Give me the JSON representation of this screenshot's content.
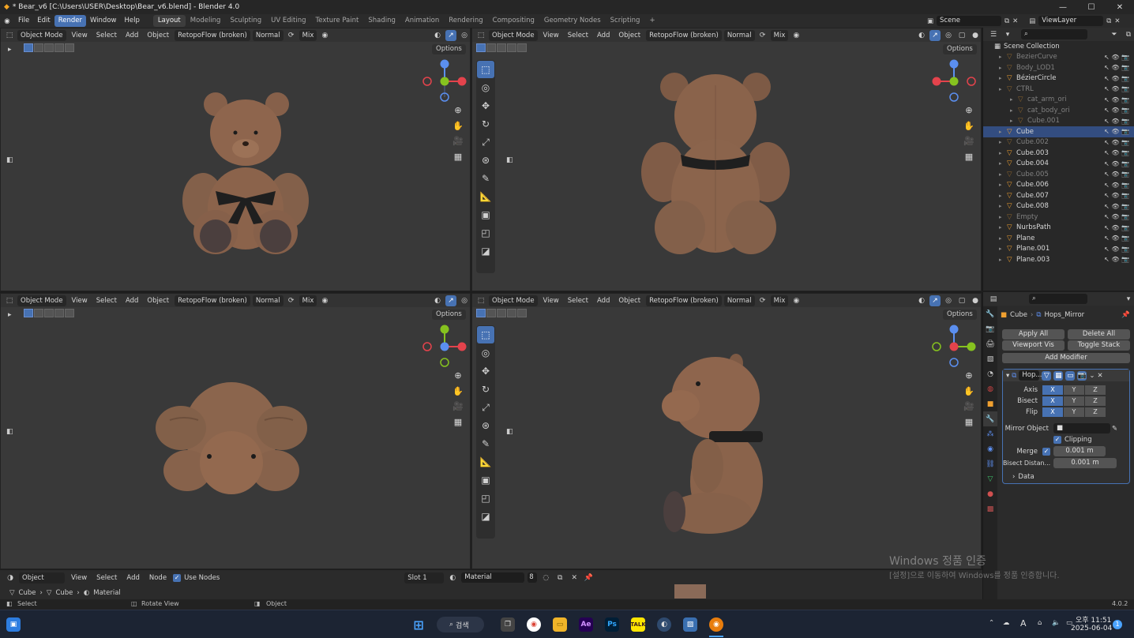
{
  "window": {
    "title": "* Bear_v6 [C:\\Users\\USER\\Desktop\\Bear_v6.blend] - Blender 4.0"
  },
  "menu": {
    "items": [
      "File",
      "Edit",
      "Render",
      "Window",
      "Help"
    ],
    "active": "Render"
  },
  "workspaces": [
    "Layout",
    "Modeling",
    "Sculpting",
    "UV Editing",
    "Texture Paint",
    "Shading",
    "Animation",
    "Rendering",
    "Compositing",
    "Geometry Nodes",
    "Scripting"
  ],
  "workspace_active": "Layout",
  "scene": {
    "name": "Scene",
    "view_layer": "ViewLayer"
  },
  "viewport_header": {
    "mode": "Object Mode",
    "view": "View",
    "select": "Select",
    "add": "Add",
    "object": "Object",
    "addon": "RetopoFlow (broken)",
    "orientation": "Normal",
    "mix": "Mix",
    "options": "Options"
  },
  "outliner": {
    "title": "Scene Collection",
    "items": [
      {
        "name": "BezierCurve",
        "dim": true,
        "selected": false
      },
      {
        "name": "Body_LOD1",
        "dim": true,
        "selected": false
      },
      {
        "name": "BézierCircle",
        "dim": false,
        "selected": false
      },
      {
        "name": "CTRL",
        "dim": true,
        "selected": false
      },
      {
        "name": "cat_arm_ori",
        "dim": true,
        "selected": false
      },
      {
        "name": "cat_body_ori",
        "dim": true,
        "selected": false
      },
      {
        "name": "Cube.001",
        "dim": true,
        "selected": false
      },
      {
        "name": "Cube",
        "dim": false,
        "selected": true
      },
      {
        "name": "Cube.002",
        "dim": true,
        "selected": false
      },
      {
        "name": "Cube.003",
        "dim": false,
        "selected": false
      },
      {
        "name": "Cube.004",
        "dim": false,
        "selected": false
      },
      {
        "name": "Cube.005",
        "dim": true,
        "selected": false
      },
      {
        "name": "Cube.006",
        "dim": false,
        "selected": false
      },
      {
        "name": "Cube.007",
        "dim": false,
        "selected": false
      },
      {
        "name": "Cube.008",
        "dim": false,
        "selected": false
      },
      {
        "name": "Empty",
        "dim": true,
        "selected": false
      },
      {
        "name": "NurbsPath",
        "dim": false,
        "selected": false
      },
      {
        "name": "Plane",
        "dim": false,
        "selected": false
      },
      {
        "name": "Plane.001",
        "dim": false,
        "selected": false
      },
      {
        "name": "Plane.003",
        "dim": false,
        "selected": false
      }
    ]
  },
  "properties": {
    "breadcrumb_object": "Cube",
    "breadcrumb_modifier": "Hops_Mirror",
    "apply_all": "Apply All",
    "delete_all": "Delete All",
    "viewport_vis": "Viewport Vis",
    "toggle_stack": "Toggle Stack",
    "add_modifier": "Add Modifier",
    "modifier_name": "Hop...",
    "axis_label": "Axis",
    "bisect_label": "Bisect",
    "flip_label": "Flip",
    "x": "X",
    "y": "Y",
    "z": "Z",
    "mirror_object_label": "Mirror Object",
    "clipping_label": "Clipping",
    "merge_label": "Merge",
    "merge_value": "0.001 m",
    "bisect_distance_label": "Bisect Distan...",
    "bisect_distance_value": "0.001 m",
    "data_label": "Data"
  },
  "shader_header": {
    "editor": "Object",
    "view": "View",
    "select": "Select",
    "add": "Add",
    "node": "Node",
    "use_nodes": "Use Nodes",
    "slot": "Slot 1",
    "material": "Material",
    "users": "8"
  },
  "breadcrumbs": [
    "Cube",
    "Cube",
    "Material"
  ],
  "statusbar": {
    "select": "Select",
    "rotate": "Rotate View",
    "object": "Object",
    "version": "4.0.2"
  },
  "watermark": {
    "line1": "Windows 정품 인증",
    "line2": "[설정]으로 이동하여 Windows를 정품 인증합니다."
  },
  "taskbar": {
    "search": "검색",
    "time": "오후 11:51",
    "date": "2025-06-04",
    "notif": "1",
    "lang": "A"
  },
  "colors": {
    "accent": "#4772b3",
    "bear": "#8a6048",
    "bow": "#1e1e1e"
  }
}
